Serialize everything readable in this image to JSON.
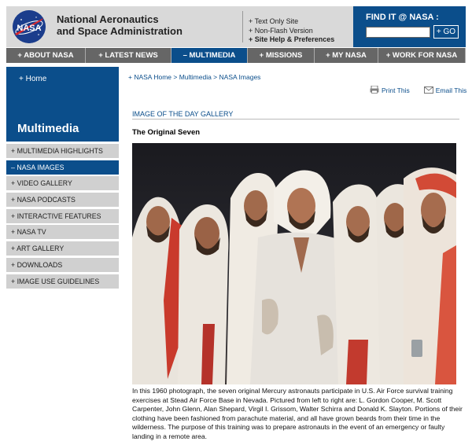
{
  "header": {
    "agency_line1": "National Aeronautics",
    "agency_line2": "and Space Administration",
    "util_links": [
      "+ Text Only Site",
      "+ Non-Flash Version",
      "+ Site Help & Preferences"
    ],
    "find_title": "FIND IT @ NASA :",
    "find_button": "+ GO",
    "logo_text": "NASA"
  },
  "nav": [
    "+ ABOUT NASA",
    "+ LATEST NEWS",
    "– MULTIMEDIA",
    "+ MISSIONS",
    "+ MY NASA",
    "+ WORK FOR NASA"
  ],
  "sidebar": {
    "home": "+ Home",
    "title": "Multimedia",
    "items": [
      "+ MULTIMEDIA HIGHLIGHTS",
      "– NASA IMAGES",
      "+ VIDEO GALLERY",
      "+ NASA PODCASTS",
      "+ INTERACTIVE FEATURES",
      "+ NASA TV",
      "+ ART GALLERY",
      "+ DOWNLOADS",
      "+ IMAGE USE GUIDELINES"
    ]
  },
  "breadcrumb": "+ NASA Home > Multimedia > NASA Images",
  "tools": {
    "print": "Print This",
    "email": "Email This"
  },
  "gallery_title": "IMAGE OF THE DAY GALLERY",
  "image_title": "The Original Seven",
  "caption": "In this 1960 photograph, the seven original Mercury astronauts participate in U.S. Air Force survival training exercises at Stead Air Force Base in Nevada. Pictured from left to right are: L. Gordon Cooper, M. Scott Carpenter, John Glenn, Alan Shepard, Virgil I. Grissom, Walter Schirra and Donald K. Slayton. Portions of their clothing have been fashioned from parachute material, and all have grown beards from their time in the wilderness. The purpose of this training was to prepare astronauts in the event of an emergency or faulty landing in a remote area.",
  "colors": {
    "brand_blue": "#0b4e8b",
    "nav_gray": "#666666",
    "side_gray": "#d0d0d0"
  }
}
